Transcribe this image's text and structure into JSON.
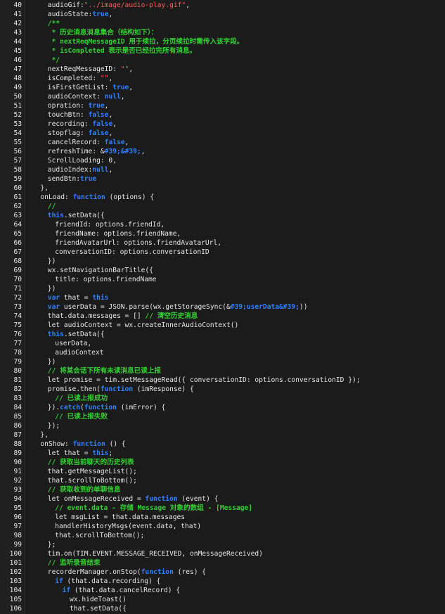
{
  "editor": {
    "colors": {
      "background": "#1b1b1b",
      "gutter": "#202020",
      "plain": "#e6e6e6",
      "keyword": "#2f80ff",
      "string": "#ff5a5a",
      "comment": "#2fd12f"
    },
    "lines": [
      {
        "n": "40",
        "i": 2,
        "t": [
          [
            "p",
            "audioGif:"
          ],
          [
            "str",
            "\"../image/audio-play.gif\""
          ],
          [
            "p",
            ","
          ]
        ]
      },
      {
        "n": "41",
        "i": 2,
        "t": [
          [
            "p",
            "audioState:"
          ],
          [
            "kw",
            "true"
          ],
          [
            "p",
            ","
          ]
        ]
      },
      {
        "n": "42",
        "i": 2,
        "t": [
          [
            "com",
            "/**"
          ]
        ]
      },
      {
        "n": "43",
        "i": 2,
        "t": [
          [
            "com",
            " * 历史消息消息集合（结构如下）："
          ]
        ]
      },
      {
        "n": "44",
        "i": 2,
        "t": [
          [
            "com",
            " * nextReqMessageID 用于续拉，分页续拉时需传入该字段。"
          ]
        ]
      },
      {
        "n": "45",
        "i": 2,
        "t": [
          [
            "com",
            " * isCompleted 表示是否已经拉完所有消息。"
          ]
        ]
      },
      {
        "n": "46",
        "i": 2,
        "t": [
          [
            "com",
            " */"
          ]
        ]
      },
      {
        "n": "47",
        "i": 2,
        "t": [
          [
            "p",
            "nextReqMessageID: "
          ],
          [
            "str",
            "\"\""
          ],
          [
            "p",
            ","
          ]
        ]
      },
      {
        "n": "48",
        "i": 2,
        "t": [
          [
            "p",
            "isCompleted: "
          ],
          [
            "str",
            "\"\""
          ],
          [
            "p",
            ","
          ]
        ]
      },
      {
        "n": "49",
        "i": 2,
        "t": [
          [
            "p",
            "isFirstGetList: "
          ],
          [
            "kw",
            "true"
          ],
          [
            "p",
            ","
          ]
        ]
      },
      {
        "n": "50",
        "i": 2,
        "t": [
          [
            "p",
            "audioContext: "
          ],
          [
            "kw",
            "null"
          ],
          [
            "p",
            ","
          ]
        ]
      },
      {
        "n": "51",
        "i": 2,
        "t": [
          [
            "p",
            "opration: "
          ],
          [
            "kw",
            "true"
          ],
          [
            "p",
            ","
          ]
        ]
      },
      {
        "n": "52",
        "i": 2,
        "t": [
          [
            "p",
            "touchBtn: "
          ],
          [
            "kw",
            "false"
          ],
          [
            "p",
            ","
          ]
        ]
      },
      {
        "n": "53",
        "i": 2,
        "t": [
          [
            "p",
            "recording: "
          ],
          [
            "kw",
            "false"
          ],
          [
            "p",
            ","
          ]
        ]
      },
      {
        "n": "54",
        "i": 2,
        "t": [
          [
            "p",
            "stopflag: "
          ],
          [
            "kw",
            "false"
          ],
          [
            "p",
            ","
          ]
        ]
      },
      {
        "n": "55",
        "i": 2,
        "t": [
          [
            "p",
            "cancelRecord: "
          ],
          [
            "kw",
            "false"
          ],
          [
            "p",
            ","
          ]
        ]
      },
      {
        "n": "56",
        "i": 2,
        "t": [
          [
            "p",
            "refreshTime: "
          ],
          [
            "p",
            "&"
          ],
          [
            "kw",
            "#39;&#39;"
          ],
          [
            "p",
            ","
          ]
        ]
      },
      {
        "n": "57",
        "i": 2,
        "t": [
          [
            "p",
            "ScrollLoading: 0,"
          ]
        ]
      },
      {
        "n": "58",
        "i": 2,
        "t": [
          [
            "p",
            "audioIndex:"
          ],
          [
            "kw",
            "null"
          ],
          [
            "p",
            ","
          ]
        ]
      },
      {
        "n": "59",
        "i": 2,
        "t": [
          [
            "p",
            "sendBtn:"
          ],
          [
            "kw",
            "true"
          ]
        ]
      },
      {
        "n": "60",
        "i": 1,
        "t": [
          [
            "p",
            "},"
          ]
        ]
      },
      {
        "n": "61",
        "i": 1,
        "t": [
          [
            "p",
            "onLoad: "
          ],
          [
            "kw",
            "function"
          ],
          [
            "p",
            " (options) {"
          ]
        ]
      },
      {
        "n": "62",
        "i": 2,
        "t": [
          [
            "com",
            "//"
          ]
        ]
      },
      {
        "n": "63",
        "i": 2,
        "t": [
          [
            "kw",
            "this"
          ],
          [
            "p",
            ".setData({"
          ]
        ]
      },
      {
        "n": "64",
        "i": 3,
        "t": [
          [
            "p",
            "friendId: options.friendId,"
          ]
        ]
      },
      {
        "n": "65",
        "i": 3,
        "t": [
          [
            "p",
            "friendName: options.friendName,"
          ]
        ]
      },
      {
        "n": "66",
        "i": 3,
        "t": [
          [
            "p",
            "friendAvatarUrl: options.friendAvatarUrl,"
          ]
        ]
      },
      {
        "n": "67",
        "i": 3,
        "t": [
          [
            "p",
            "conversationID: options.conversationID"
          ]
        ]
      },
      {
        "n": "68",
        "i": 2,
        "t": [
          [
            "p",
            "})"
          ]
        ]
      },
      {
        "n": "69",
        "i": 2,
        "t": [
          [
            "p",
            "wx.setNavigationBarTitle({"
          ]
        ]
      },
      {
        "n": "70",
        "i": 3,
        "t": [
          [
            "p",
            "title: options.friendName"
          ]
        ]
      },
      {
        "n": "71",
        "i": 2,
        "t": [
          [
            "p",
            "})"
          ]
        ]
      },
      {
        "n": "72",
        "i": 2,
        "t": [
          [
            "kw",
            "var"
          ],
          [
            "p",
            " that = "
          ],
          [
            "kw",
            "this"
          ]
        ]
      },
      {
        "n": "73",
        "i": 2,
        "t": [
          [
            "kw",
            "var"
          ],
          [
            "p",
            " userData = JSON.parse(wx.getStorageSync(&"
          ],
          [
            "kw",
            "#39;userData&#39;"
          ],
          [
            "p",
            "))"
          ]
        ]
      },
      {
        "n": "74",
        "i": 2,
        "t": [
          [
            "p",
            "that.data.messages = [] "
          ],
          [
            "com",
            "// 清空历史消息"
          ]
        ]
      },
      {
        "n": "75",
        "i": 2,
        "t": [
          [
            "p",
            "let audioContext = wx.createInnerAudioContext()"
          ]
        ]
      },
      {
        "n": "76",
        "i": 2,
        "t": [
          [
            "kw",
            "this"
          ],
          [
            "p",
            ".setData({"
          ]
        ]
      },
      {
        "n": "77",
        "i": 3,
        "t": [
          [
            "p",
            "userData,"
          ]
        ]
      },
      {
        "n": "78",
        "i": 3,
        "t": [
          [
            "p",
            "audioContext"
          ]
        ]
      },
      {
        "n": "79",
        "i": 2,
        "t": [
          [
            "p",
            "})"
          ]
        ]
      },
      {
        "n": "80",
        "i": 2,
        "t": [
          [
            "com",
            "// 将某会话下所有未读消息已读上报"
          ]
        ]
      },
      {
        "n": "81",
        "i": 2,
        "t": [
          [
            "p",
            "let promise = tim.setMessageRead({ conversationID: options.conversationID });"
          ]
        ]
      },
      {
        "n": "82",
        "i": 2,
        "t": [
          [
            "p",
            "promise.then("
          ],
          [
            "kw",
            "function"
          ],
          [
            "p",
            " (imResponse) {"
          ]
        ]
      },
      {
        "n": "83",
        "i": 3,
        "t": [
          [
            "com",
            "// 已读上报成功"
          ]
        ]
      },
      {
        "n": "84",
        "i": 2,
        "t": [
          [
            "p",
            "})."
          ],
          [
            "kw",
            "catch"
          ],
          [
            "p",
            "("
          ],
          [
            "kw",
            "function"
          ],
          [
            "p",
            " (imError) {"
          ]
        ]
      },
      {
        "n": "85",
        "i": 3,
        "t": [
          [
            "com",
            "// 已读上报失败"
          ]
        ]
      },
      {
        "n": "86",
        "i": 2,
        "t": [
          [
            "p",
            "});"
          ]
        ]
      },
      {
        "n": "87",
        "i": 1,
        "t": [
          [
            "p",
            "},"
          ]
        ]
      },
      {
        "n": "88",
        "i": 1,
        "t": [
          [
            "p",
            "onShow: "
          ],
          [
            "kw",
            "function"
          ],
          [
            "p",
            " () {"
          ]
        ]
      },
      {
        "n": "89",
        "i": 2,
        "t": [
          [
            "p",
            "let that = "
          ],
          [
            "kw",
            "this"
          ],
          [
            "p",
            ";"
          ]
        ]
      },
      {
        "n": "90",
        "i": 2,
        "t": [
          [
            "com",
            "// 获取当前聊天的历史列表"
          ]
        ]
      },
      {
        "n": "91",
        "i": 2,
        "t": [
          [
            "p",
            "that.getMessageList();"
          ]
        ]
      },
      {
        "n": "92",
        "i": 2,
        "t": [
          [
            "p",
            "that.scrollToBottom();"
          ]
        ]
      },
      {
        "n": "93",
        "i": 2,
        "t": [
          [
            "com",
            "// 获取收到的单聊信息"
          ]
        ]
      },
      {
        "n": "94",
        "i": 2,
        "t": [
          [
            "p",
            "let onMessageReceived = "
          ],
          [
            "kw",
            "function"
          ],
          [
            "p",
            " (event) {"
          ]
        ]
      },
      {
        "n": "95",
        "i": 3,
        "t": [
          [
            "com",
            "// event.data - 存储 Message 对象的数组 - [Message]"
          ]
        ]
      },
      {
        "n": "96",
        "i": 3,
        "t": [
          [
            "p",
            "let msgList = that.data.messages"
          ]
        ]
      },
      {
        "n": "97",
        "i": 3,
        "t": [
          [
            "p",
            "handlerHistoryMsgs(event.data, that)"
          ]
        ]
      },
      {
        "n": "98",
        "i": 3,
        "t": [
          [
            "p",
            "that.scrollToBottom();"
          ]
        ]
      },
      {
        "n": "99",
        "i": 2,
        "t": [
          [
            "p",
            "};"
          ]
        ]
      },
      {
        "n": "100",
        "i": 2,
        "t": [
          [
            "p",
            "tim.on(TIM.EVENT.MESSAGE_RECEIVED, onMessageReceived)"
          ]
        ]
      },
      {
        "n": "101",
        "i": 2,
        "t": [
          [
            "com",
            "// 监听录音结束"
          ]
        ]
      },
      {
        "n": "102",
        "i": 2,
        "t": [
          [
            "p",
            "recorderManager.onStop("
          ],
          [
            "kw",
            "function"
          ],
          [
            "p",
            " (res) {"
          ]
        ]
      },
      {
        "n": "103",
        "i": 3,
        "t": [
          [
            "kw",
            "if"
          ],
          [
            "p",
            " (that.data.recording) {"
          ]
        ]
      },
      {
        "n": "104",
        "i": 4,
        "t": [
          [
            "kw",
            "if"
          ],
          [
            "p",
            " (that.data.cancelRecord) {"
          ]
        ]
      },
      {
        "n": "105",
        "i": 5,
        "t": [
          [
            "p",
            "wx.hideToast()"
          ]
        ]
      },
      {
        "n": "106",
        "i": 5,
        "t": [
          [
            "p",
            "that.setData({"
          ]
        ]
      }
    ]
  }
}
